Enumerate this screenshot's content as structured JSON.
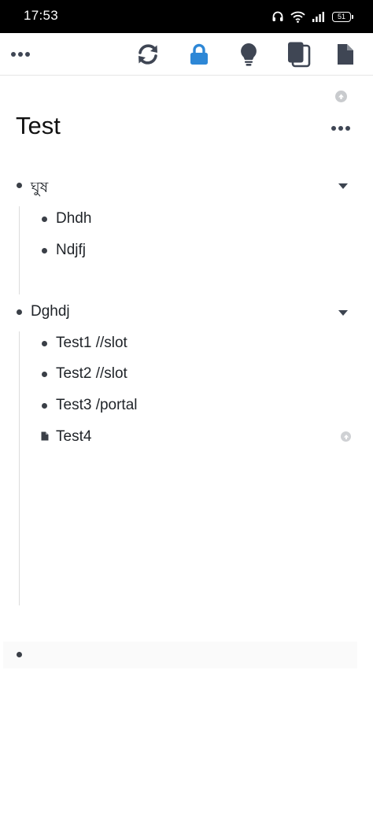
{
  "status_bar": {
    "time": "17:53",
    "battery": "51"
  },
  "toolbar": {
    "menu_icon": "more-horizontal-icon",
    "sync_icon": "sync-icon",
    "lock_icon": "lock-icon",
    "idea_icon": "lightbulb-icon",
    "copy_icon": "copy-icon",
    "doc_icon": "document-icon",
    "accent_color": "#2d87d6"
  },
  "page": {
    "title": "Test"
  },
  "outline": [
    {
      "label": "ঘুষ",
      "expanded": true,
      "children": [
        {
          "label": "Dhdh"
        },
        {
          "label": "Ndjfj"
        }
      ]
    },
    {
      "label": "Dghdj",
      "expanded": true,
      "children": [
        {
          "label": "Test1 //slot"
        },
        {
          "label": "Test2 //slot"
        },
        {
          "label": "Test3 /portal"
        },
        {
          "label": "Test4",
          "type": "document"
        }
      ]
    }
  ]
}
